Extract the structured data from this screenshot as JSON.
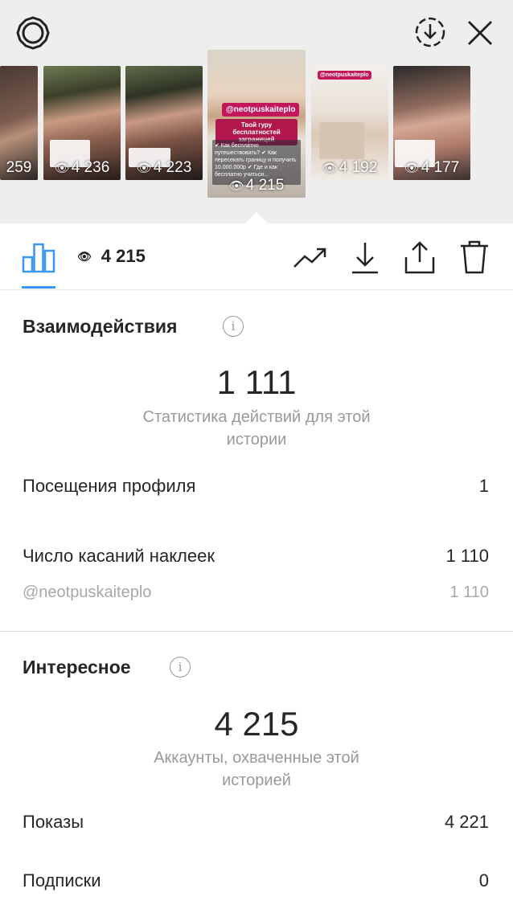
{
  "header": {
    "thumbs": [
      {
        "views": "259"
      },
      {
        "views": "4 236"
      },
      {
        "views": "4 223"
      },
      {
        "views": "4 215",
        "tag": "@neotpuskaiteplo",
        "tag2": "Твой гуру бесплатностей заграницей",
        "text": "✔ Как бесплатно путешествовать? ✔ Как пересекать границу и получить 10.000.000р ✔ Где и как бесплатно учиться..."
      },
      {
        "views": "4 192",
        "tag": "@neotpuskaiteplo"
      },
      {
        "views": "4 177"
      }
    ]
  },
  "toolbar": {
    "views": "4 215"
  },
  "interactions": {
    "title": "Взаимодействия",
    "total": "1 111",
    "subtitle_line1": "Статистика действий для этой",
    "subtitle_line2": "истории",
    "rows": [
      {
        "label": "Посещения профиля",
        "value": "1"
      },
      {
        "label": "Число касаний наклеек",
        "value": "1 110"
      },
      {
        "label": "@neotpuskaiteplo",
        "value": "1 110"
      }
    ]
  },
  "discovery": {
    "title": "Интересное",
    "total": "4 215",
    "subtitle_line1": "Аккаунты, охваченные этой",
    "subtitle_line2": "историей",
    "rows": [
      {
        "label": "Показы",
        "value": "4 221"
      },
      {
        "label": "Подписки",
        "value": "0"
      }
    ]
  },
  "colors": {
    "accent": "#3897f0",
    "tag": "#c2185b"
  },
  "icons": [
    "settings-icon",
    "download-circle-icon",
    "close-icon",
    "bar-chart-icon",
    "eye-icon",
    "trend-icon",
    "download-icon",
    "share-icon",
    "trash-icon",
    "info-icon"
  ]
}
